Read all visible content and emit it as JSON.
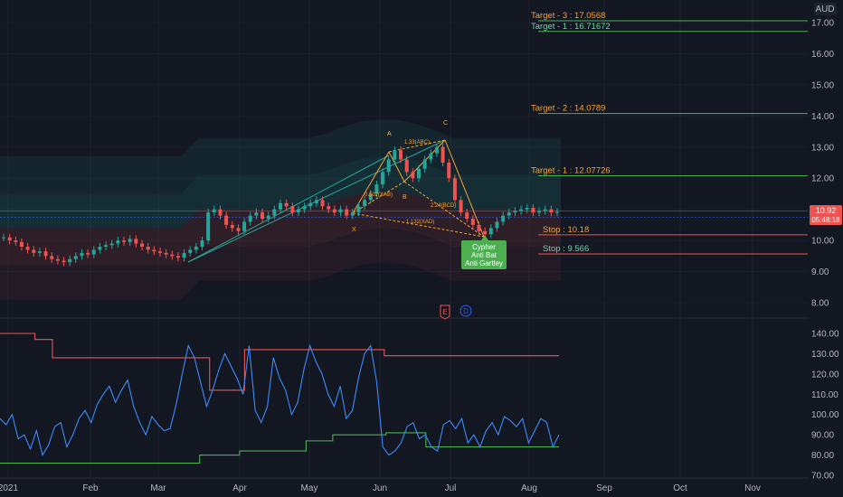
{
  "currency": "AUD",
  "price_badge": {
    "price": "10.92",
    "time": "05:48:18"
  },
  "events": {
    "earnings": "E",
    "dividend": "D"
  },
  "pattern_points": {
    "A": "A",
    "C": "C",
    "X": "X",
    "B": "B"
  },
  "pattern_ratios": {
    "abc": "1.33(ABC)",
    "xab": "0.502(XAB)",
    "bcd": "2.24(BCD)",
    "xad": "1.132(XAD)"
  },
  "pattern_label": [
    "Cypher",
    "Anti Bat",
    "Anti Gartley"
  ],
  "levels": [
    {
      "label": "Target - 3 : 17.0568",
      "value": 17.0568,
      "color": "#f7a233",
      "line": "#4caf50"
    },
    {
      "label": "Target - 1 : 16.71672",
      "value": 16.71672,
      "color": "#6fd3a8",
      "line": "#4caf50"
    },
    {
      "label": "Target - 2 : 14.0789",
      "value": 14.0789,
      "color": "#f7a233",
      "line": "#4caf50"
    },
    {
      "label": "Target - 1 : 12.07726",
      "value": 12.07726,
      "color": "#f7a233",
      "line": "#4caf50"
    },
    {
      "label": "Stop : 10.18",
      "value": 10.18,
      "color": "#f7a233",
      "line": "#ef5350"
    },
    {
      "label": "Stop : 9.566",
      "value": 9.566,
      "color": "#6fd3a8",
      "line": "#ef5350"
    }
  ],
  "colors": {
    "up": "#26a69a",
    "down": "#ef5350",
    "osc": "#2962ff",
    "accent": "#f7a233"
  },
  "chart_data": [
    {
      "type": "candlestick",
      "title": "",
      "ylim": [
        7.5,
        18.3
      ],
      "y_ticks": [
        "17.00",
        "16.00",
        "15.00",
        "14.00",
        "13.00",
        "12.00",
        "11.00",
        "10.00",
        "9.00",
        "8.00"
      ],
      "x_ticks": [
        "2021",
        "Feb",
        "Mar",
        "Apr",
        "May",
        "Jun",
        "Jul",
        "Aug",
        "Sep",
        "Oct",
        "Nov"
      ],
      "close_series": [
        10.1,
        10.0,
        9.95,
        9.8,
        9.7,
        9.6,
        9.65,
        9.5,
        9.4,
        9.35,
        9.3,
        9.4,
        9.5,
        9.6,
        9.55,
        9.7,
        9.8,
        9.85,
        9.9,
        10.0,
        9.95,
        10.05,
        9.9,
        9.8,
        9.7,
        9.65,
        9.6,
        9.55,
        9.5,
        9.45,
        9.6,
        9.7,
        9.8,
        10.0,
        10.9,
        11.0,
        10.8,
        10.5,
        10.4,
        10.3,
        10.6,
        10.8,
        10.9,
        10.7,
        10.8,
        11.0,
        11.2,
        11.1,
        10.9,
        11.0,
        11.1,
        11.2,
        11.3,
        11.1,
        11.0,
        10.9,
        11.0,
        10.8,
        10.9,
        11.1,
        11.3,
        11.5,
        11.8,
        12.2,
        12.6,
        12.9,
        12.6,
        12.2,
        12.0,
        12.3,
        12.6,
        12.8,
        13.0,
        12.5,
        12.0,
        11.3,
        10.9,
        10.7,
        10.5,
        10.3,
        10.2,
        10.4,
        10.6,
        10.8,
        10.9,
        10.95,
        11.0,
        11.05,
        10.9,
        10.95,
        11.0,
        10.9,
        10.92
      ],
      "oscillator": {
        "ylim": [
          68,
          144
        ],
        "y_ticks": [
          "140.00",
          "130.00",
          "120.00",
          "110.00",
          "100.00",
          "90.00",
          "80.00",
          "70.00"
        ],
        "values": [
          98,
          95,
          100,
          88,
          90,
          83,
          92,
          80,
          85,
          94,
          96,
          84,
          90,
          98,
          102,
          96,
          105,
          110,
          114,
          106,
          112,
          117,
          104,
          96,
          90,
          99,
          95,
          92,
          93,
          105,
          120,
          134,
          128,
          116,
          104,
          112,
          122,
          130,
          124,
          118,
          110,
          134,
          102,
          96,
          104,
          128,
          118,
          112,
          100,
          106,
          122,
          134,
          126,
          120,
          110,
          104,
          114,
          98,
          102,
          118,
          130,
          134,
          116,
          84,
          80,
          82,
          86,
          94,
          96,
          88,
          90,
          84,
          82,
          95,
          97,
          93,
          98,
          86,
          90,
          84,
          92,
          96,
          90,
          99,
          97,
          94,
          98,
          86,
          92,
          98,
          96,
          84,
          90
        ],
        "upper_band": [
          140,
          140,
          137,
          128,
          128,
          128,
          128,
          128,
          128,
          128,
          128,
          128,
          112,
          112,
          132,
          132,
          132,
          132,
          132,
          132,
          132,
          132,
          129,
          129,
          129,
          129,
          129,
          129,
          129,
          129,
          129,
          129,
          129
        ],
        "lower_band": [
          76,
          76,
          76,
          76,
          76,
          76,
          76,
          76,
          76,
          76,
          76,
          76,
          76,
          76,
          76,
          80,
          80,
          80,
          82,
          82,
          82,
          82,
          82,
          87,
          87,
          90,
          90,
          90,
          90,
          91,
          91,
          91,
          84,
          84,
          84,
          84,
          84,
          84,
          84,
          84,
          84,
          84,
          84
        ]
      }
    }
  ]
}
